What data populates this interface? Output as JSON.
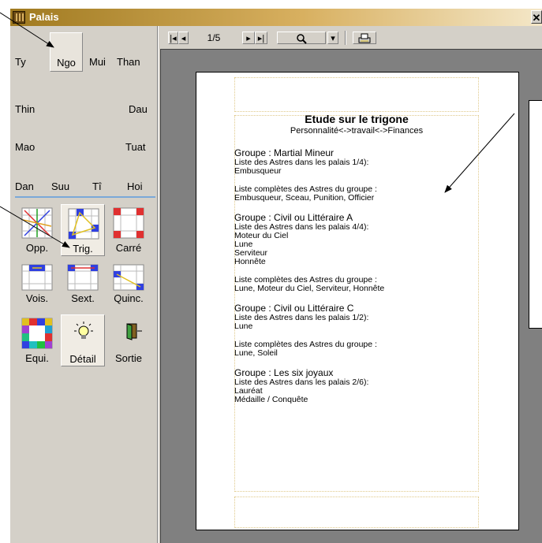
{
  "window": {
    "title": "Palais",
    "close_label": "✕"
  },
  "palaces": {
    "row1": [
      "Ty",
      "Ngo",
      "Mui",
      "Than"
    ],
    "row2": [
      "Thin",
      "Dau"
    ],
    "row3": [
      "Mao",
      "Tuat"
    ],
    "row4": [
      "Dan",
      "Suu",
      "Tî",
      "Hoi"
    ]
  },
  "tools": {
    "opp": "Opp.",
    "trig": "Trig.",
    "carre": "Carré",
    "vois": "Vois.",
    "sext": "Sext.",
    "quinc": "Quinc.",
    "equi": "Equi.",
    "detail": "Détail",
    "sortie": "Sortie"
  },
  "toolbar": {
    "first_icon": "first-page-icon",
    "prev_icon": "prev-page-icon",
    "page_indicator": "1/5",
    "next_icon": "next-page-icon",
    "last_icon": "last-page-icon",
    "zoom_icon": "magnifier-icon",
    "dropdown_icon": "chevron-down-icon",
    "print_icon": "printer-icon"
  },
  "document": {
    "title": "Etude sur le trigone",
    "subtitle": "Personnalité<->travail<->Finances",
    "groups": [
      {
        "name": "Groupe : Martial Mineur",
        "list_header": "Liste des Astres dans les palais 1/4):",
        "list": [
          "Embusqueur"
        ],
        "complete_header": "Liste complètes des Astres du groupe :",
        "complete": "Embusqueur, Sceau, Punition, Officier"
      },
      {
        "name": "Groupe : Civil ou Littéraire A",
        "list_header": "Liste des Astres dans les palais 4/4):",
        "list": [
          "Moteur du Ciel",
          "Lune",
          "Serviteur",
          "Honnête"
        ],
        "complete_header": "Liste complètes des Astres du groupe :",
        "complete": "Lune, Moteur du Ciel, Serviteur, Honnête"
      },
      {
        "name": "Groupe : Civil ou Littéraire C",
        "list_header": "Liste des Astres dans les palais 1/2):",
        "list": [
          "Lune"
        ],
        "complete_header": "Liste complètes des Astres du groupe :",
        "complete": "Lune, Soleil"
      },
      {
        "name": "Groupe : Les six joyaux",
        "list_header": "Liste des Astres dans les palais 2/6):",
        "list": [
          "Lauréat",
          "Médaille / Conquête"
        ]
      }
    ]
  },
  "colors": {
    "panel": "#d4d0c8",
    "title_gradient_start": "#a07a20",
    "separator": "#7aa8d8"
  }
}
